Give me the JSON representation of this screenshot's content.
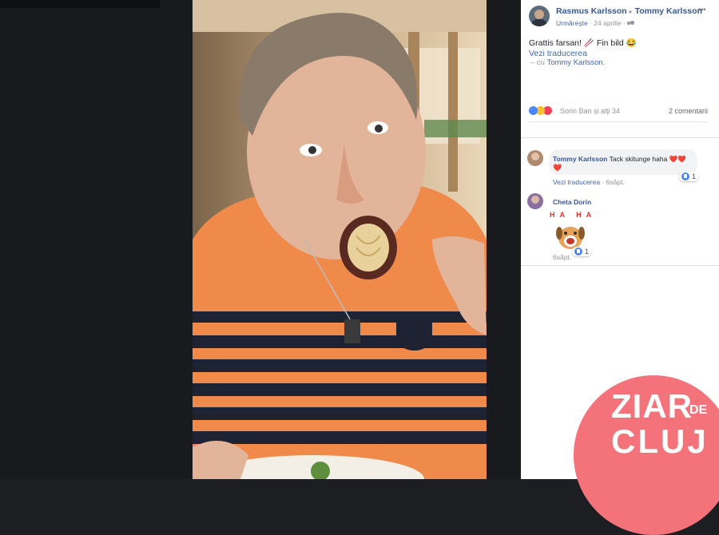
{
  "post": {
    "author": "Rasmus Karlsson",
    "arrow": "▸",
    "tagged": "Tommy Karlsson",
    "more_icon": "•••",
    "follow": "Urmărește",
    "dot": "·",
    "date": "24 aprilie",
    "text": "Grattis farsan! 🥢 Fin bild 😂",
    "translate": "Vezi traducerea",
    "with_prefix": "– cu",
    "with_name": "Tommy Karlsson."
  },
  "reactions": {
    "summary": "Sorin Ban și alți 34",
    "comments_count": "2 comentarii"
  },
  "comments": [
    {
      "author": "Tommy Karlsson",
      "text": "Tack skitunge haha ❤️❤️",
      "text_line2": "❤️",
      "translate": "Vezi traducerea",
      "time": "6săpt.",
      "likes": "1"
    },
    {
      "author": "Cheta Dorin",
      "sticker_text": "HA HA",
      "time": "6săpt.",
      "likes": "1"
    }
  ],
  "watermark": {
    "line1": "ZIAR",
    "small": "DE",
    "line2": "CLUJ",
    "color": "#f4737a"
  },
  "colors": {
    "link": "#4267b2",
    "name": "#365899",
    "muted": "#90949c",
    "like": "#4a86f7",
    "shirt_orange": "#ef8a4b"
  }
}
